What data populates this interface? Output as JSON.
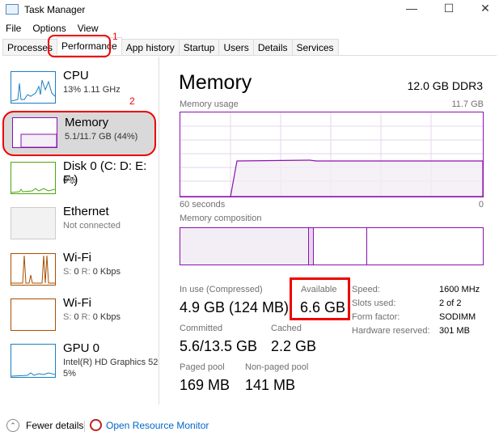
{
  "window": {
    "title": "Task Manager",
    "icon": "task-manager-icon",
    "controls": [
      "minimize",
      "maximize",
      "close"
    ]
  },
  "menu": [
    "File",
    "Options",
    "View"
  ],
  "tabs": [
    {
      "label": "Processes"
    },
    {
      "label": "Performance",
      "active": true
    },
    {
      "label": "App history"
    },
    {
      "label": "Startup"
    },
    {
      "label": "Users"
    },
    {
      "label": "Details"
    },
    {
      "label": "Services"
    }
  ],
  "annotations": {
    "tab": "1",
    "sidebar": "2",
    "color": "#e00000"
  },
  "sidebar": {
    "items": [
      {
        "name": "CPU",
        "sub": "13% 1.11 GHz",
        "color": "#1b7ec2"
      },
      {
        "name": "Memory",
        "sub": "5.1/11.7 GB (44%)",
        "color": "#8b12ae",
        "selected": true
      },
      {
        "name": "Disk 0 (C: D: E: F:)",
        "sub": "0%",
        "color": "#4da60c"
      },
      {
        "name": "Ethernet",
        "sub": "Not connected",
        "color": "#bbbbbb"
      },
      {
        "name": "Wi-Fi",
        "s": "S:",
        "sv": "0",
        "r": "R:",
        "rv": "0 Kbps",
        "color": "#a74f01"
      },
      {
        "name": "Wi-Fi",
        "s": "S:",
        "sv": "0",
        "r": "R:",
        "rv": "0 Kbps",
        "color": "#a74f01"
      },
      {
        "name": "GPU 0",
        "sub": "Intel(R) HD Graphics 520",
        "sub2": "5%",
        "color": "#1b7ec2"
      }
    ]
  },
  "main": {
    "title": "Memory",
    "spec": "12.0 GB DDR3",
    "usage_label": "Memory usage",
    "usage_max": "11.7 GB",
    "x_left": "60 seconds",
    "x_right": "0",
    "composition_label": "Memory composition",
    "accent": "#8b12ae",
    "stats": {
      "in_use_label": "In use (Compressed)",
      "in_use": "4.9 GB (124 MB)",
      "available_label": "Available",
      "available": "6.6 GB",
      "committed_label": "Committed",
      "committed": "5.6/13.5 GB",
      "cached_label": "Cached",
      "cached": "2.2 GB",
      "paged_label": "Paged pool",
      "paged": "169 MB",
      "nonpaged_label": "Non-paged pool",
      "nonpaged": "141 MB"
    },
    "props": [
      {
        "k": "Speed:",
        "v": "1600 MHz"
      },
      {
        "k": "Slots used:",
        "v": "2 of 2"
      },
      {
        "k": "Form factor:",
        "v": "SODIMM"
      },
      {
        "k": "Hardware reserved:",
        "v": "301 MB"
      }
    ]
  },
  "footer": {
    "fewer": "Fewer details",
    "monitor": "Open Resource Monitor"
  }
}
